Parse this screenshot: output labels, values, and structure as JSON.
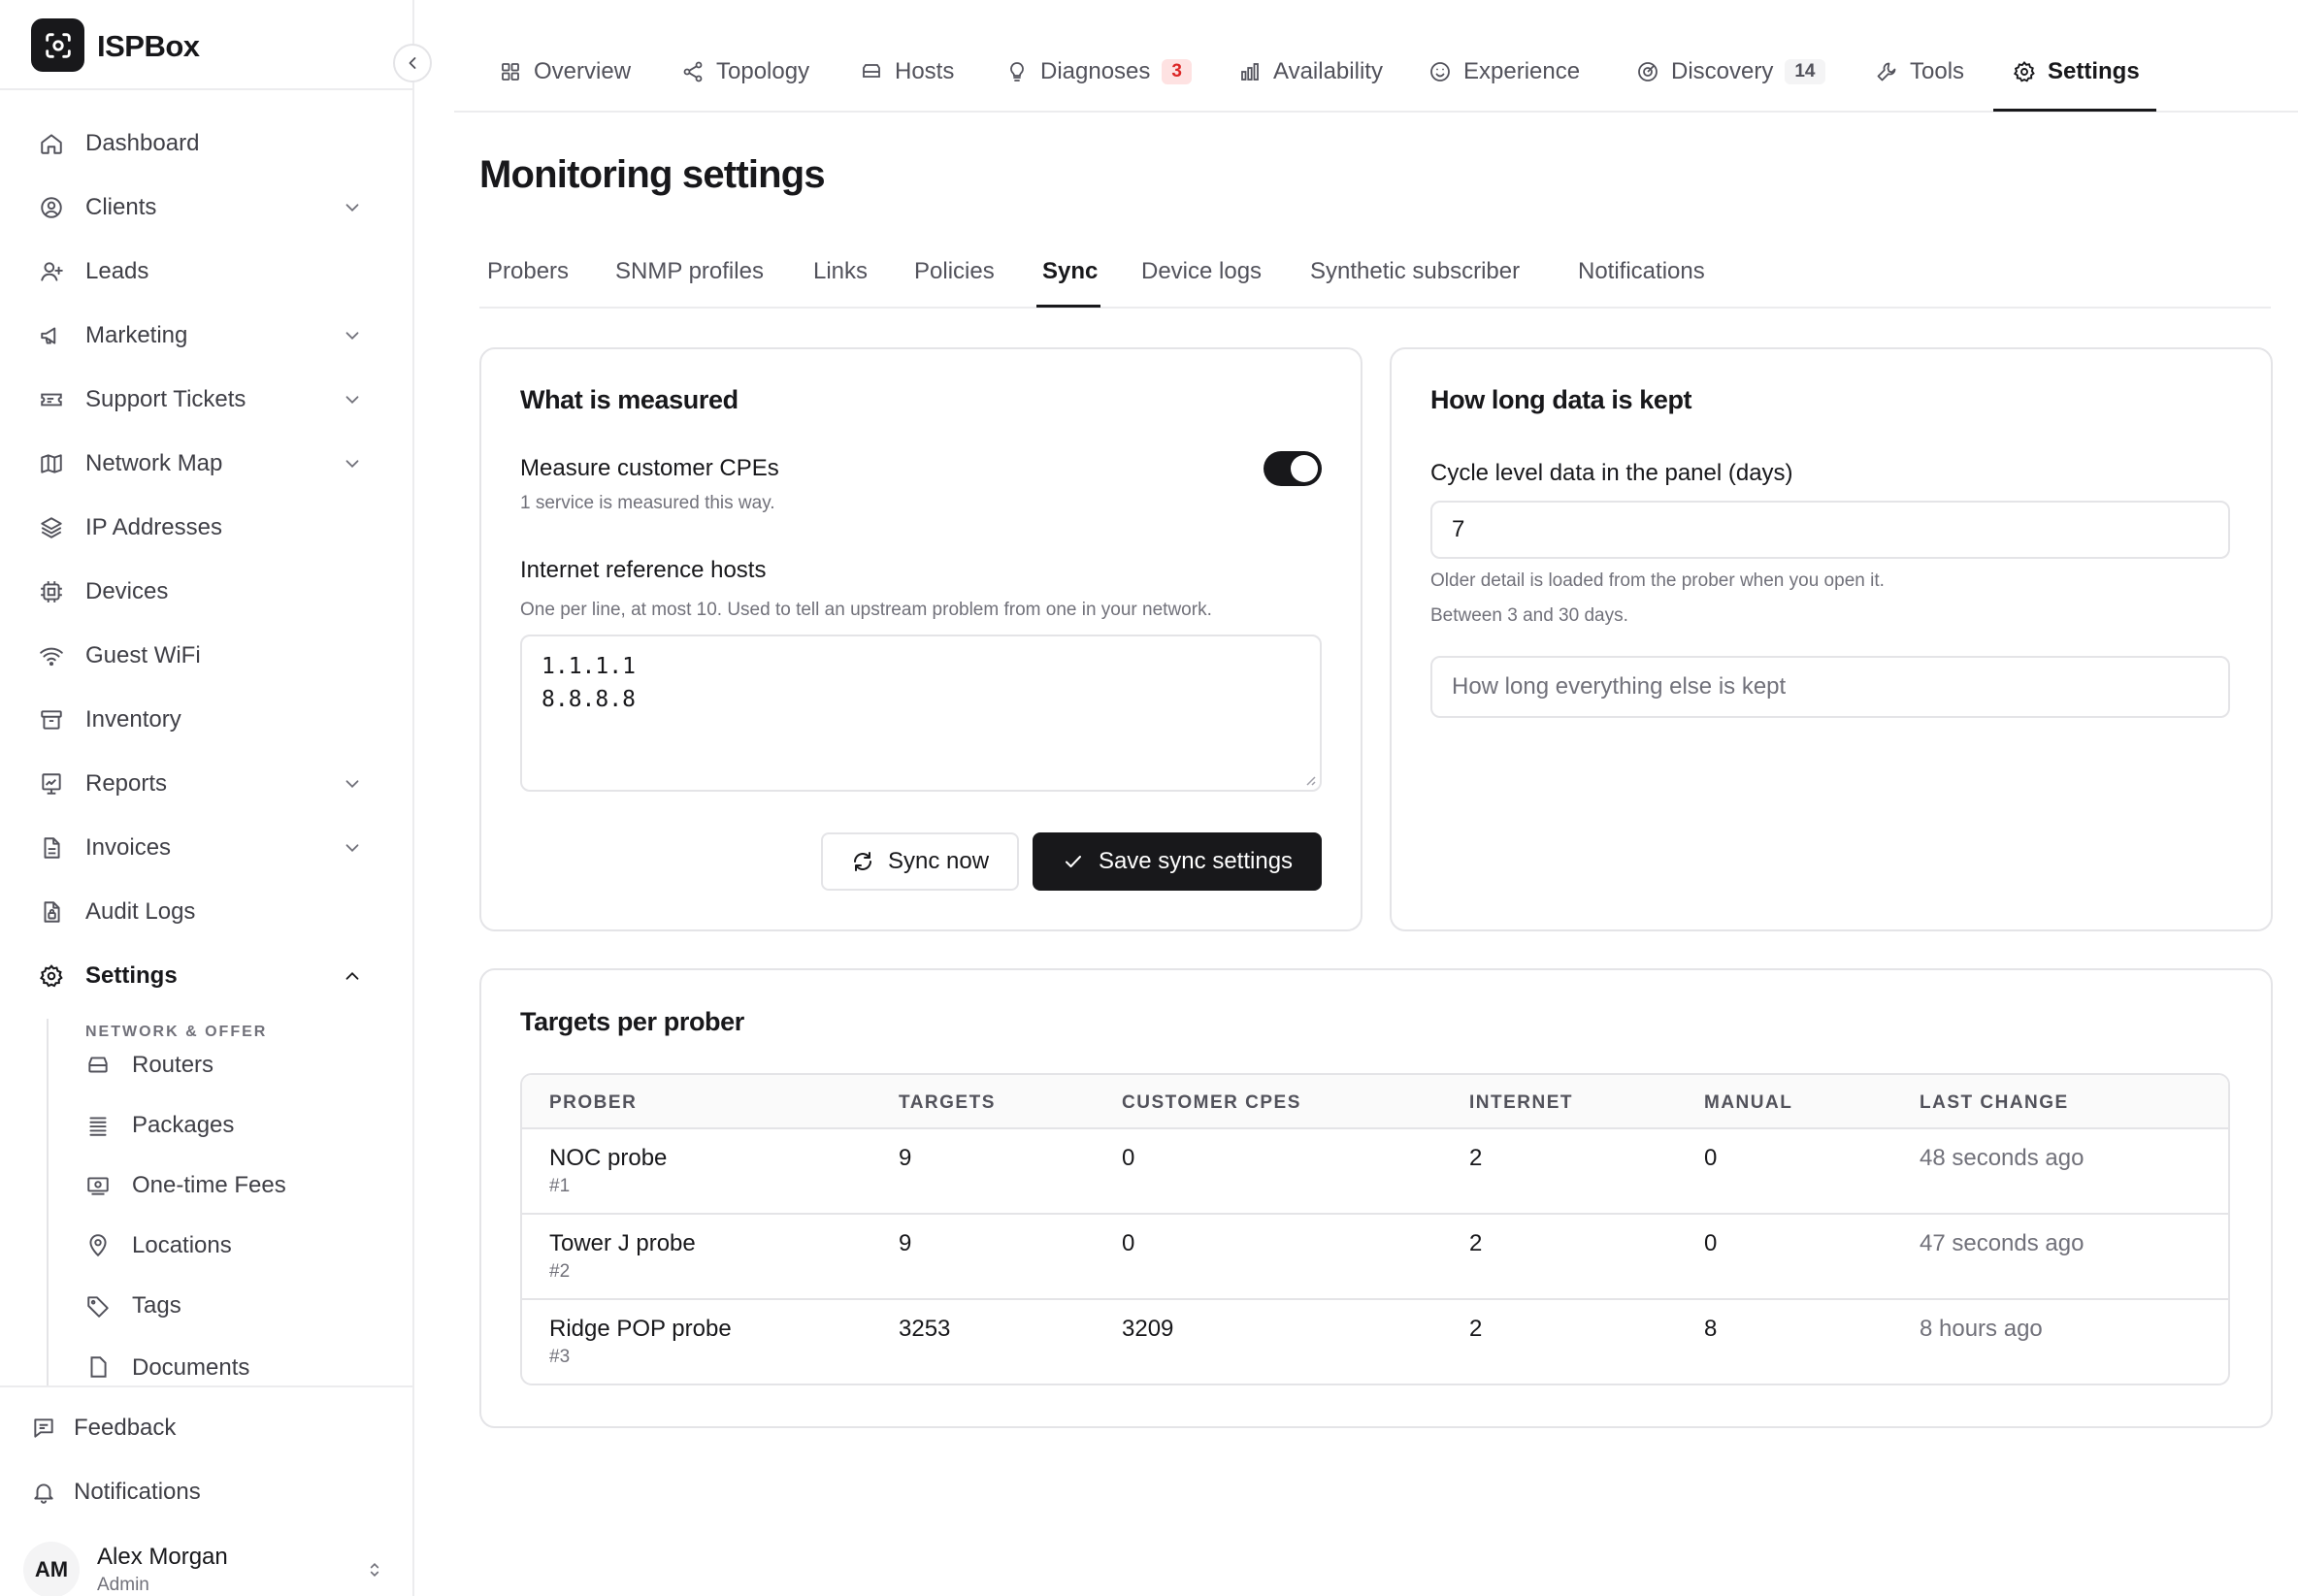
{
  "brand": {
    "name": "ISPBox"
  },
  "sidebar": {
    "items": [
      {
        "label": "Dashboard"
      },
      {
        "label": "Clients"
      },
      {
        "label": "Leads"
      },
      {
        "label": "Marketing"
      },
      {
        "label": "Support Tickets"
      },
      {
        "label": "Network Map"
      },
      {
        "label": "IP Addresses"
      },
      {
        "label": "Devices"
      },
      {
        "label": "Guest WiFi"
      },
      {
        "label": "Inventory"
      },
      {
        "label": "Reports"
      },
      {
        "label": "Invoices"
      },
      {
        "label": "Audit Logs"
      },
      {
        "label": "Settings"
      }
    ],
    "section_label": "NETWORK & OFFER",
    "sub_items": [
      {
        "label": "Routers"
      },
      {
        "label": "Packages"
      },
      {
        "label": "One-time Fees"
      },
      {
        "label": "Locations"
      },
      {
        "label": "Tags"
      },
      {
        "label": "Documents"
      }
    ],
    "footer": {
      "feedback": "Feedback",
      "notifications": "Notifications"
    },
    "user": {
      "initials": "AM",
      "name": "Alex Morgan",
      "role": "Admin"
    }
  },
  "top_tabs": [
    {
      "label": "Overview",
      "icon": "grid-icon"
    },
    {
      "label": "Topology",
      "icon": "share-icon"
    },
    {
      "label": "Hosts",
      "icon": "server-icon"
    },
    {
      "label": "Diagnoses",
      "icon": "lightbulb-icon",
      "badge": "3"
    },
    {
      "label": "Availability",
      "icon": "bar-chart-icon"
    },
    {
      "label": "Experience",
      "icon": "smile-icon"
    },
    {
      "label": "Discovery",
      "icon": "radar-icon",
      "badge": "14"
    },
    {
      "label": "Tools",
      "icon": "wrench-icon"
    },
    {
      "label": "Settings",
      "icon": "gear-icon",
      "active": true
    }
  ],
  "page": {
    "title": "Monitoring settings"
  },
  "sub_tabs": [
    {
      "label": "Probers"
    },
    {
      "label": "SNMP profiles"
    },
    {
      "label": "Links"
    },
    {
      "label": "Policies"
    },
    {
      "label": "Sync",
      "active": true
    },
    {
      "label": "Device logs"
    },
    {
      "label": "Synthetic subscriber"
    },
    {
      "label": "Notifications"
    }
  ],
  "measured": {
    "title": "What is measured",
    "cpe_label": "Measure customer CPEs",
    "cpe_help": "1 service is measured this way.",
    "cpe_enabled": true,
    "hosts_label": "Internet reference hosts",
    "hosts_help": "One per line, at most 10. Used to tell an upstream problem from one in your network.",
    "hosts": [
      "1.1.1.1",
      "8.8.8.8"
    ],
    "sync_now": "Sync now",
    "save": "Save sync settings"
  },
  "retention": {
    "title": "How long data is kept",
    "cycle_label": "Cycle level data in the panel (days)",
    "cycle_value": "7",
    "help_1": "Older detail is loaded from the prober when you open it.",
    "help_2": "Between 3 and 30 days.",
    "other_placeholder": "How long everything else is kept"
  },
  "targets": {
    "title": "Targets per prober",
    "headers": [
      "PROBER",
      "TARGETS",
      "CUSTOMER CPES",
      "INTERNET",
      "MANUAL",
      "LAST CHANGE"
    ],
    "rows": [
      {
        "name": "NOC probe",
        "id": "#1",
        "targets": "9",
        "cpes": "0",
        "internet": "2",
        "manual": "0",
        "last": "48 seconds ago"
      },
      {
        "name": "Tower J probe",
        "id": "#2",
        "targets": "9",
        "cpes": "0",
        "internet": "2",
        "manual": "0",
        "last": "47 seconds ago"
      },
      {
        "name": "Ridge POP probe",
        "id": "#3",
        "targets": "3253",
        "cpes": "3209",
        "internet": "2",
        "manual": "8",
        "last": "8 hours ago"
      }
    ]
  },
  "colors": {
    "primary": "#18181b",
    "border": "#e4e4e7",
    "muted": "#71717a",
    "badge_red": "#dc2626"
  }
}
